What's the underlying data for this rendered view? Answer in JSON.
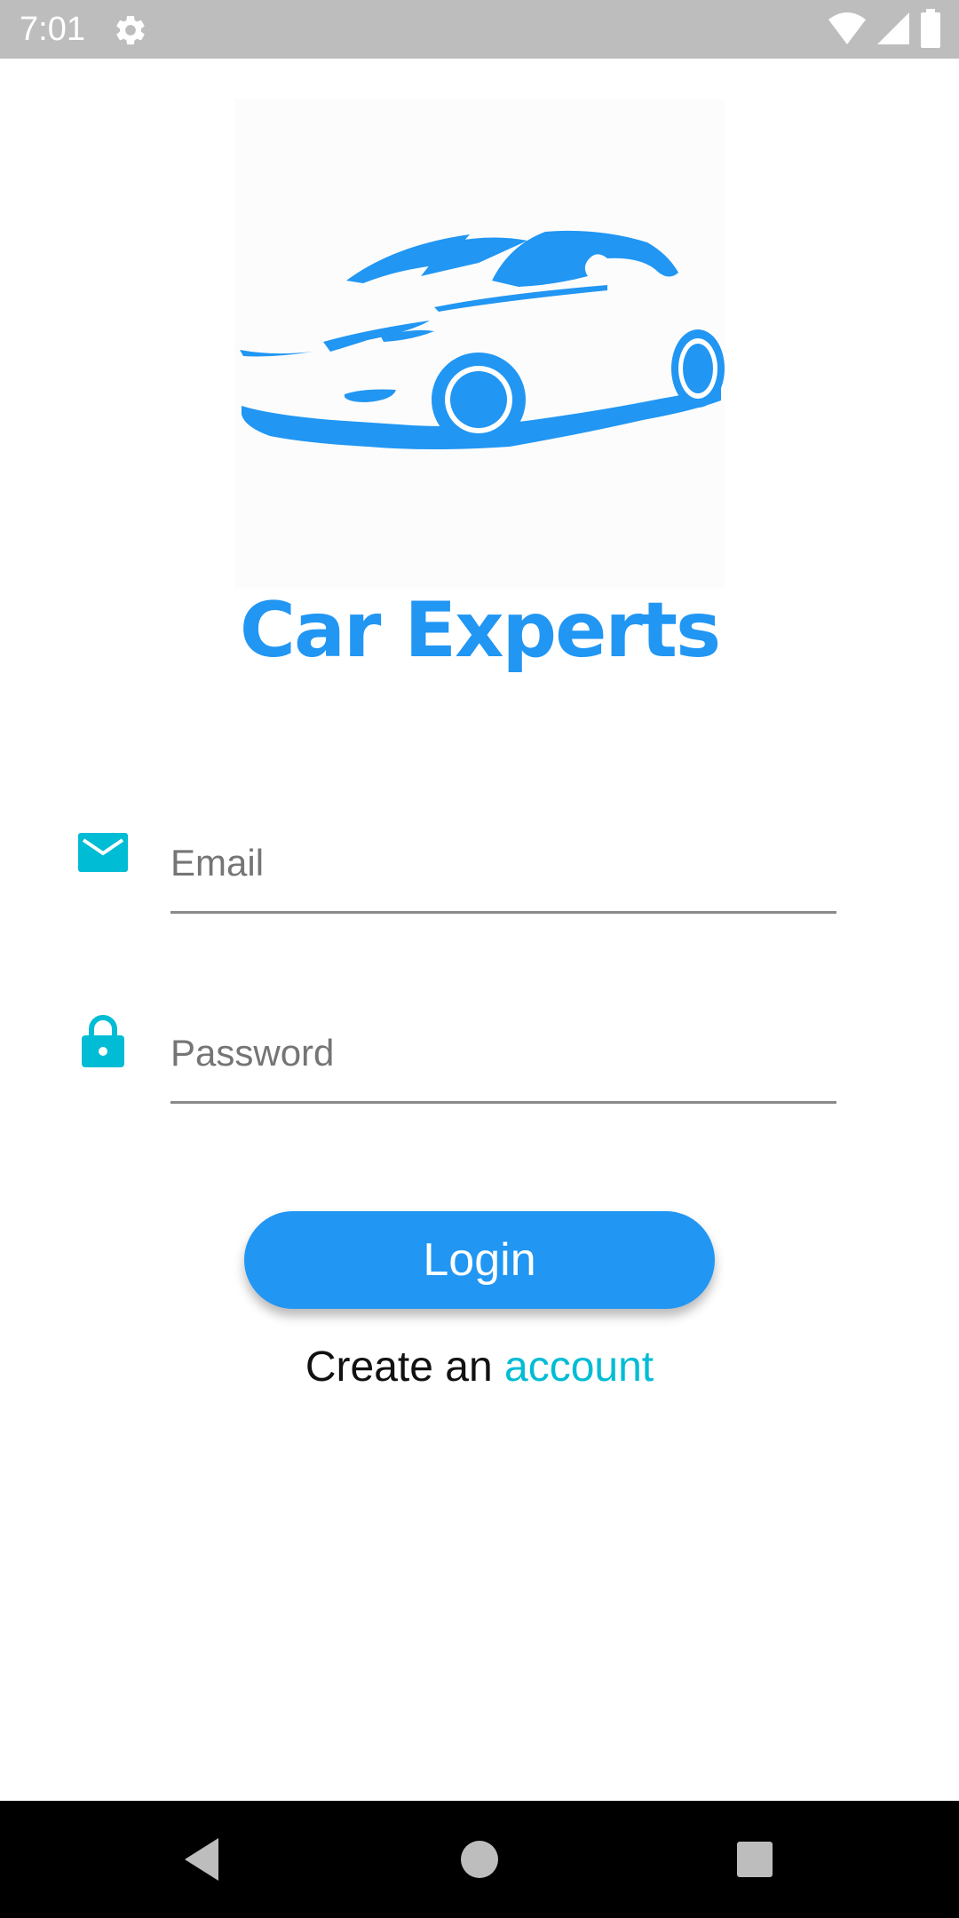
{
  "status_bar": {
    "time": "7:01",
    "icons": [
      "settings-gear-icon",
      "wifi-icon",
      "cell-signal-icon",
      "battery-icon"
    ]
  },
  "logo": {
    "icon": "car-logo-icon",
    "title": "Car Experts"
  },
  "form": {
    "email": {
      "icon": "email-icon",
      "placeholder": "Email",
      "value": ""
    },
    "password": {
      "icon": "lock-icon",
      "placeholder": "Password",
      "value": ""
    },
    "login_label": "Login",
    "create_prefix": "Create an ",
    "create_link": "account"
  },
  "nav_bar": {
    "icons": [
      "back-icon",
      "home-icon",
      "recents-icon"
    ]
  },
  "colors": {
    "primary": "#2196f3",
    "accent": "#00bcd4",
    "status_bar": "#bdbdbd",
    "nav_bar": "#000000"
  }
}
